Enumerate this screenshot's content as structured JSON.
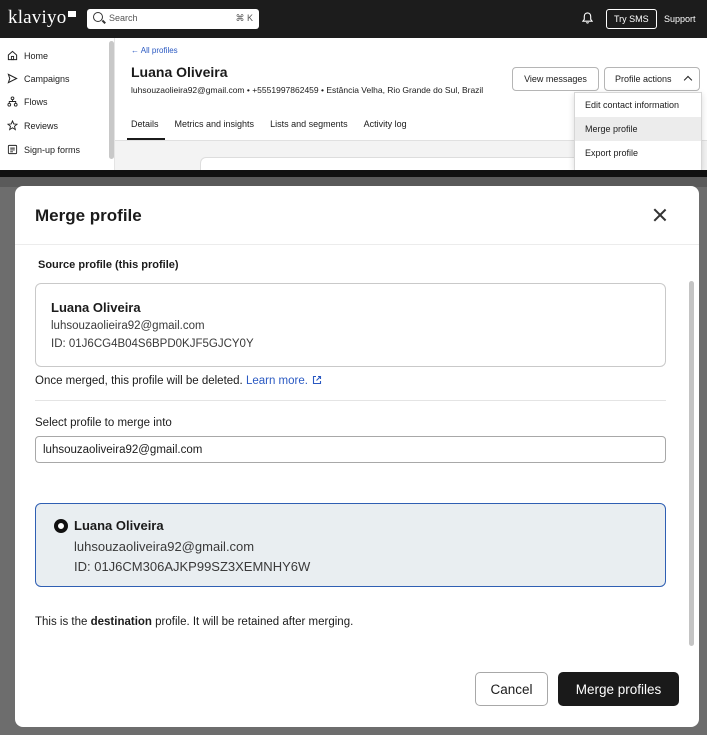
{
  "topbar": {
    "logo": "klaviyo",
    "search_placeholder": "Search",
    "search_shortcut": "⌘ K",
    "try_sms": "Try SMS",
    "support": "Support"
  },
  "sidebar": {
    "items": [
      {
        "label": "Home",
        "icon": "home-icon"
      },
      {
        "label": "Campaigns",
        "icon": "send-icon"
      },
      {
        "label": "Flows",
        "icon": "flows-icon"
      },
      {
        "label": "Reviews",
        "icon": "star-icon"
      },
      {
        "label": "Sign-up forms",
        "icon": "form-icon"
      }
    ]
  },
  "profile": {
    "back_link": "← All profiles",
    "name": "Luana Oliveira",
    "meta": "luhsouzaolieira92@gmail.com • +5551997862459 • Estância Velha, Rio Grande do Sul, Brazil",
    "view_messages": "View messages",
    "profile_actions": "Profile actions",
    "tabs": [
      "Details",
      "Metrics and insights",
      "Lists and segments",
      "Activity log"
    ],
    "active_tab": "Details"
  },
  "actions_menu": {
    "items": [
      "Edit contact information",
      "Merge profile",
      "Export profile"
    ],
    "highlighted": "Merge profile"
  },
  "modal": {
    "title": "Merge profile",
    "source_label": "Source profile (this profile)",
    "source": {
      "name": "Luana Oliveira",
      "email": "luhsouzaolieira92@gmail.com",
      "id": "ID: 01J6CG4B04S6BPD0KJF5GJCY0Y"
    },
    "deleted_note": "Once merged, this profile will be deleted.",
    "learn_more": "Learn more.",
    "select_label": "Select profile to merge into",
    "select_value": "luhsouzaoliveira92@gmail.com",
    "destination": {
      "name": "Luana Oliveira",
      "email": "luhsouzaoliveira92@gmail.com",
      "id": "ID: 01J6CM306AJKP99SZ3XEMNHY6W"
    },
    "dest_note_prefix": "This is the ",
    "dest_note_bold": "destination",
    "dest_note_suffix": " profile. It will be retained after merging.",
    "cancel": "Cancel",
    "merge": "Merge profiles"
  },
  "colors": {
    "topbar": "#1c1c1c",
    "link": "#2a59c2",
    "selected_border": "#2f5fb3",
    "selected_bg": "#e9eef1",
    "primary_button": "#1a1a1a"
  }
}
